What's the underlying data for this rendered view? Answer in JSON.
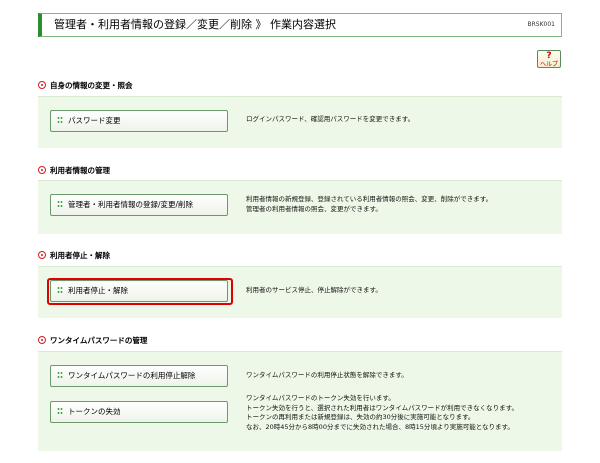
{
  "header": {
    "title": "管理者・利用者情報の登録／変更／削除 》 作業内容選択",
    "code": "BRSK001"
  },
  "help": {
    "mark": "?",
    "label": "ヘルプ"
  },
  "sections": {
    "self": {
      "title": "自身の情報の変更・照会",
      "button": "パスワード変更",
      "desc": [
        "ログインパスワード、確認用パスワードを変更できます。"
      ]
    },
    "user_info": {
      "title": "利用者情報の管理",
      "button": "管理者・利用者情報の登録/変更/削除",
      "desc": [
        "利用者情報の新規登録、登録されている利用者情報の照会、変更、削除ができます。",
        "管理者の利用者情報の照会、変更ができます。"
      ]
    },
    "stop": {
      "title": "利用者停止・解除",
      "button": "利用者停止・解除",
      "desc": [
        "利用者のサービス停止、停止解除ができます。"
      ]
    },
    "otp": {
      "title": "ワンタイムパスワードの管理",
      "button1": "ワンタイムパスワードの利用停止解除",
      "desc1": [
        "ワンタイムパスワードの利用停止状態を解除できます。"
      ],
      "button2": "トークンの失効",
      "desc2": [
        "ワンタイムパスワードのトークン失効を行います。",
        "トークン失効を行うと、選択された利用者はワンタイムパスワードが利用できなくなります。",
        "トークンの再利用または新規登録は、失効の約30分後に実施可能となります。",
        "なお、20時45分から8時00分までに失効された場合、8時15分頃より実施可能となります。"
      ]
    }
  }
}
